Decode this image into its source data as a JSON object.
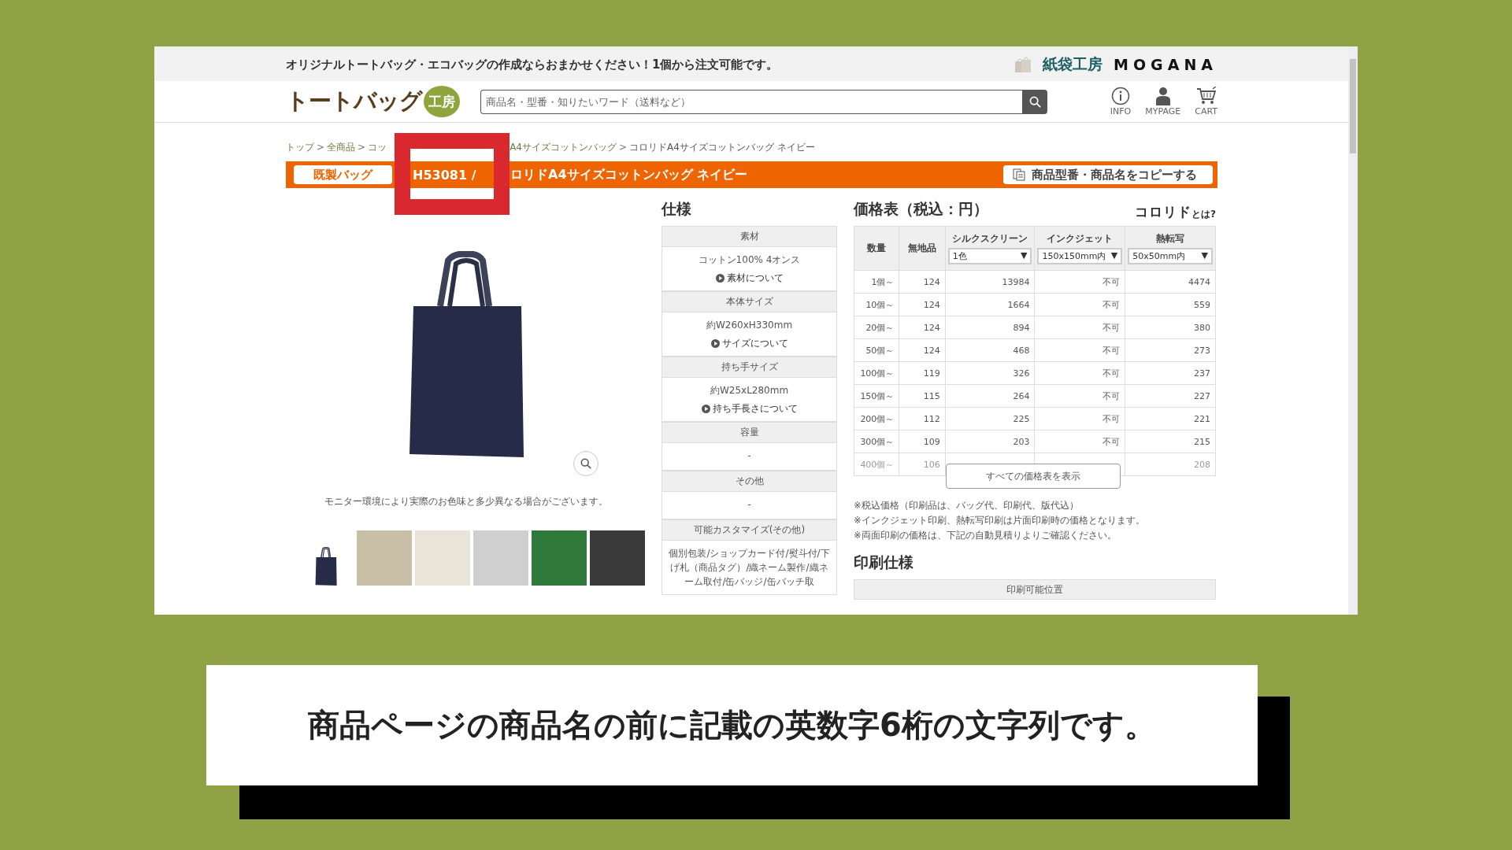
{
  "top_bar": {
    "tagline": "オリジナルトートバッグ・エコバッグの作成ならおまかせください！1個から注文可能です。",
    "brands": [
      "紙袋工房",
      "MOGANA"
    ]
  },
  "header": {
    "logo": "トートバッグ",
    "logo_badge": "工房",
    "search": {
      "placeholder": "商品名・型番・知りたいワード（送料など）"
    },
    "nav": [
      {
        "label": "INFO",
        "kind": "info"
      },
      {
        "label": "MYPAGE",
        "kind": "user"
      },
      {
        "label": "CART",
        "kind": "cart"
      }
    ]
  },
  "breadcrumb": [
    {
      "kind": "link",
      "text": "トップ"
    },
    {
      "kind": "sep",
      "text": ">"
    },
    {
      "kind": "link",
      "text": "全商品"
    },
    {
      "kind": "sep",
      "text": ">"
    },
    {
      "kind": "link",
      "text": "コッ"
    },
    {
      "kind": "link",
      "text": "A4サイズコットンバッグ"
    },
    {
      "kind": "sep",
      "text": ">"
    },
    {
      "kind": "current",
      "text": "コロリドA4サイズコットンバッグ ネイビー"
    }
  ],
  "title_bar": {
    "category": "既製バッグ",
    "code": "H53081 /",
    "name": "ロリドA4サイズコットンバッグ ネイビー",
    "copy_button": "商品型番・商品名をコピーする"
  },
  "product": {
    "note": "モニター環境により実際のお色味と多少異なる場合がございます。",
    "thumbnails": [
      {
        "kind": "bag"
      },
      {
        "kind": "photo"
      },
      {
        "kind": "photo"
      },
      {
        "kind": "photo"
      },
      {
        "kind": "photo"
      },
      {
        "kind": "photo"
      }
    ]
  },
  "specs": {
    "title": "仕様",
    "sections": [
      {
        "label": "素材",
        "value": "コットン100% 4オンス",
        "link": "素材について"
      },
      {
        "label": "本体サイズ",
        "value": "約W260xH330mm",
        "link": "サイズについて"
      },
      {
        "label": "持ち手サイズ",
        "value": "約W25xL280mm",
        "link": "持ち手長さについて"
      },
      {
        "label": "容量",
        "value": "-"
      },
      {
        "label": "その他",
        "value": "-"
      },
      {
        "label": "可能カスタマイズ(その他)",
        "value": "個別包装/ショップカード付/熨斗付/下げ札（商品タグ）/織ネーム製作/織ネーム取付/缶バッジ/缶バッチ取"
      }
    ]
  },
  "prices": {
    "title": "価格表（税込：円）",
    "badge": "コロリド",
    "badge_suffix": "とは?",
    "columns": [
      {
        "label": "数量"
      },
      {
        "label": "無地品"
      },
      {
        "label": "シルクスクリーン",
        "select": "1色",
        "arrow": "▼"
      },
      {
        "label": "インクジェット",
        "select": "150x150mm内",
        "arrow": "▼"
      },
      {
        "label": "熱転写",
        "select": "50x50mm内",
        "arrow": "▼"
      }
    ],
    "rows": [
      {
        "cells": [
          "1個～",
          "124",
          "13984",
          "不可",
          "4474"
        ],
        "faded": false
      },
      {
        "cells": [
          "10個～",
          "124",
          "1664",
          "不可",
          "559"
        ],
        "faded": false
      },
      {
        "cells": [
          "20個～",
          "124",
          "894",
          "不可",
          "380"
        ],
        "faded": false
      },
      {
        "cells": [
          "50個～",
          "124",
          "468",
          "不可",
          "273"
        ],
        "faded": false
      },
      {
        "cells": [
          "100個～",
          "119",
          "326",
          "不可",
          "237"
        ],
        "faded": false
      },
      {
        "cells": [
          "150個～",
          "115",
          "264",
          "不可",
          "227"
        ],
        "faded": false
      },
      {
        "cells": [
          "200個～",
          "112",
          "225",
          "不可",
          "221"
        ],
        "faded": false
      },
      {
        "cells": [
          "300個～",
          "109",
          "203",
          "不可",
          "215"
        ],
        "faded": false
      },
      {
        "cells": [
          "400個～",
          "106",
          null,
          null,
          "208"
        ],
        "faded": true
      }
    ],
    "show_all": "すべての価格表を表示",
    "notes": [
      "※税込価格（印刷品は、バッグ代、印刷代、版代込）",
      "※インクジェット印刷、熱転写印刷は片面印刷時の価格となります。",
      "※両面印刷の価格は、下記の自動見積りよりご確認ください。"
    ]
  },
  "print_specs": {
    "title": "印刷仕様",
    "header": "印刷可能位置"
  },
  "caption": "商品ページの商品名の前に記載の英数字6桁の文字列です。"
}
